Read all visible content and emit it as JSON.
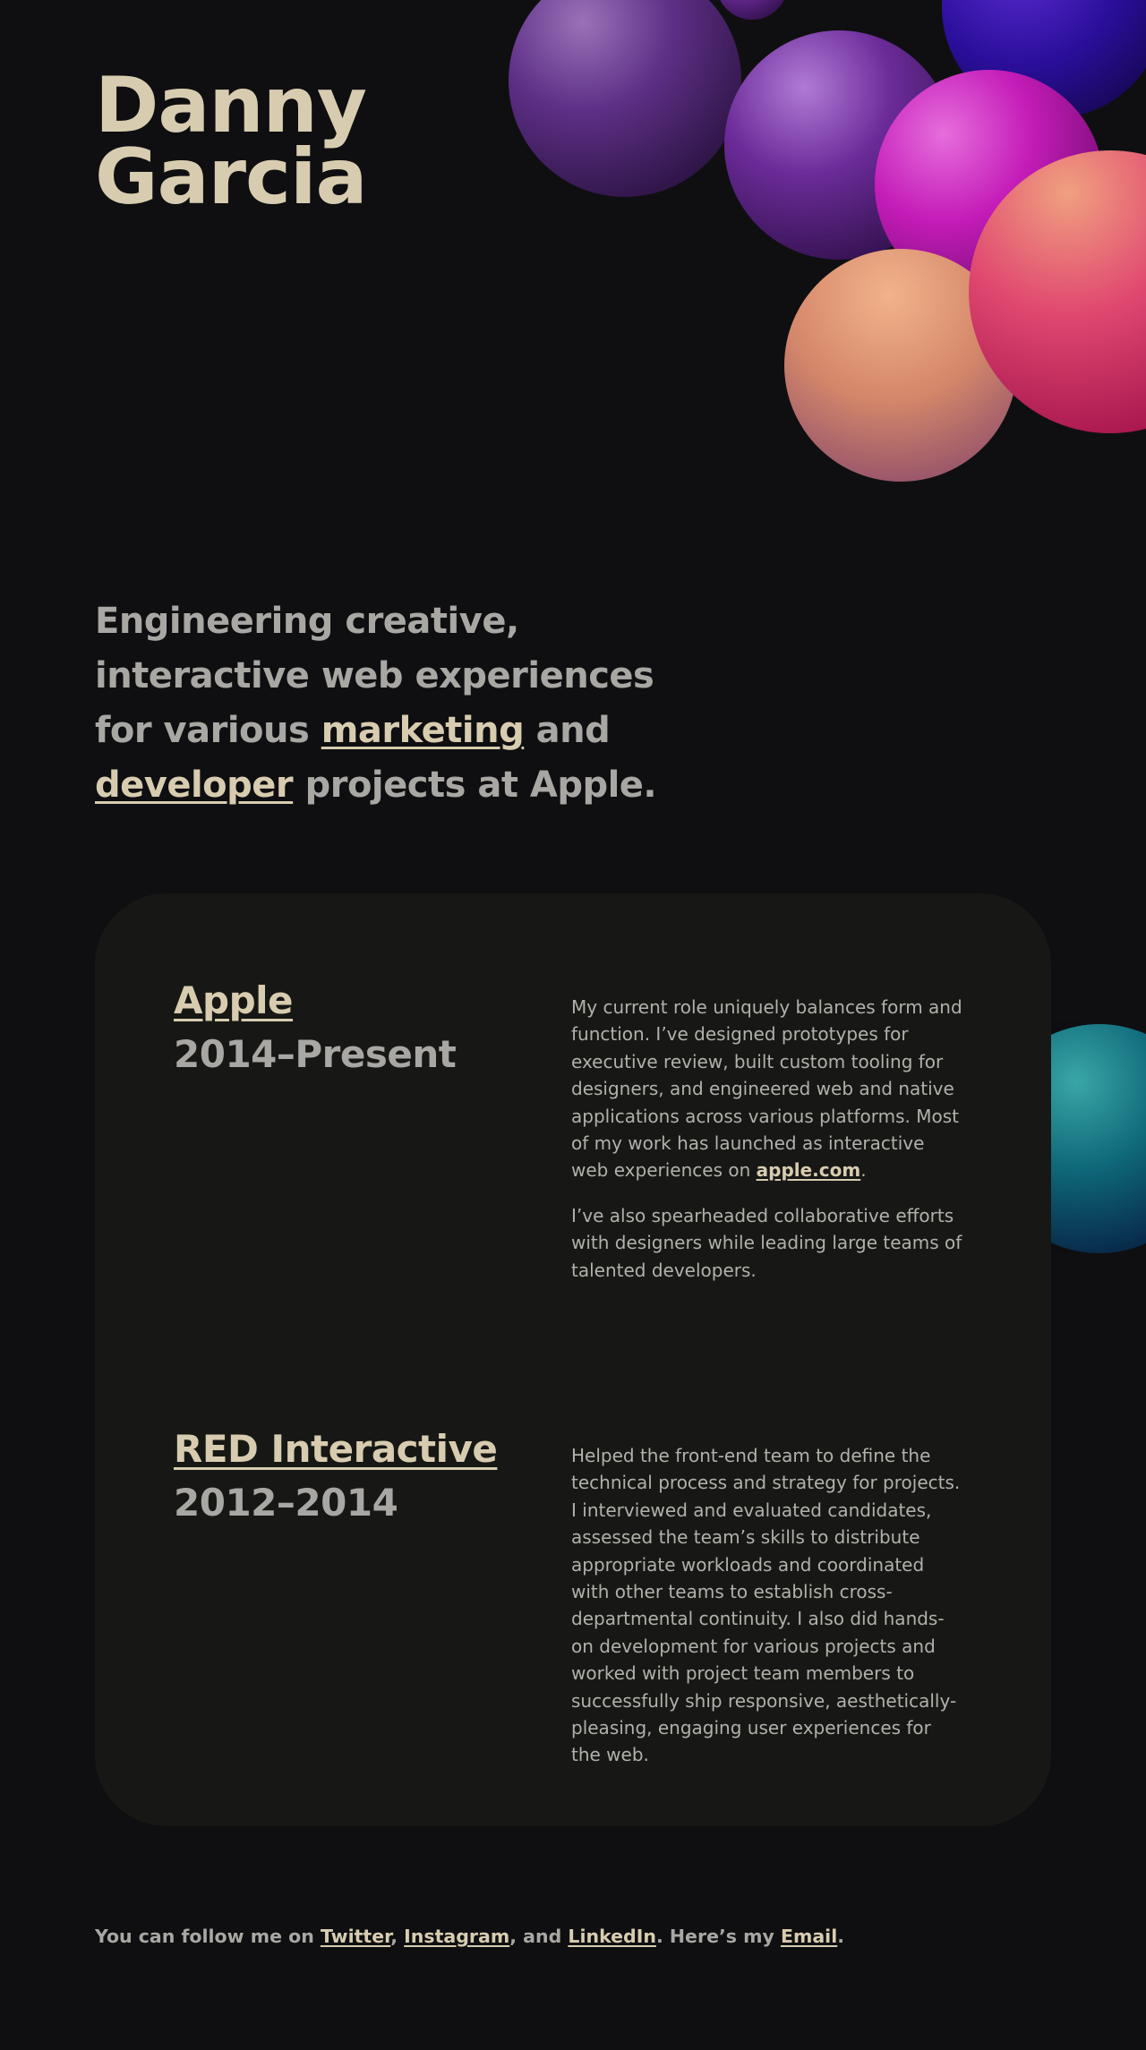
{
  "header": {
    "first_name": "Danny",
    "last_name": "Garcia"
  },
  "intro": {
    "line1": "Engineering creative, interactive web experiences for various ",
    "link_marketing": "marketing",
    "connector": " and ",
    "link_developer": "developer",
    "line_end": " projects at Apple."
  },
  "experience": [
    {
      "company": "Apple",
      "years": "2014–Present",
      "paragraph1_text": "My current role uniquely balances form and function. I’ve designed prototypes for executive review, built custom tooling for designers, and engineered web and native applications across various platforms. Most of my work has launched as interactive web experiences on ",
      "paragraph1_link": "apple.com",
      "paragraph1_end": ".",
      "paragraph2": "I’ve also spearheaded collaborative efforts with designers while leading large teams of talented developers."
    },
    {
      "company": "RED Interactive",
      "years": "2012–2014",
      "paragraph1_text": "Helped the front-end team to define the technical process and strategy for projects. I interviewed and evaluated candidates, assessed the team’s skills to distribute appropriate workloads and coordinated with other teams to establish cross-departmental continuity. I also did hands-on development for various projects and worked with project team members to successfully ship responsive, aesthetically-pleasing, engaging user experiences for the web."
    }
  ],
  "footer": {
    "prefix": "You can follow me on ",
    "twitter": "Twitter",
    "sep1": ", ",
    "instagram": "Instagram",
    "sep2": ", and ",
    "linkedin": "LinkedIn",
    "middle": ". Here’s my ",
    "email": "Email",
    "end": "."
  },
  "colors": {
    "background": "#0f0f11",
    "card": "#171815",
    "accent": "#d8ccb0",
    "text": "#a9a7a3"
  },
  "decor_icons": [
    "purple-sphere",
    "violet-sphere",
    "indigo-sphere",
    "magenta-sphere",
    "peach-sphere",
    "pink-sphere",
    "teal-sphere"
  ]
}
